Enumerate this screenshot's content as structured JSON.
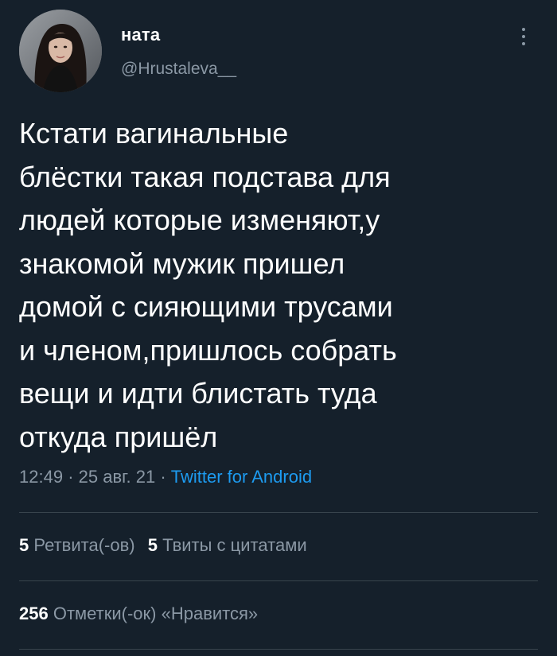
{
  "tweet": {
    "author": {
      "display_name": "ната",
      "handle": "@Hrustaleva__",
      "avatar_icon": "user-avatar-photo"
    },
    "more_icon": "vertical-ellipsis-icon",
    "text": "Кстати вагинальные\nблёстки такая подстава для\nлюдей которые изменяют,у\nзнакомой мужик пришел\nдомой с сияющими трусами\nи членом,пришлось собрать\nвещи и идти блистать туда\nоткуда пришёл",
    "time": "12:49",
    "separator": "·",
    "date": "25 авг. 21",
    "client": "Twitter for Android",
    "retweets": {
      "count": "5",
      "label": "Ретвита(-ов)"
    },
    "quotes": {
      "count": "5",
      "label": "Твиты с цитатами"
    },
    "likes": {
      "count": "256",
      "label": "Отметки(-ок) «Нравится»"
    }
  },
  "colors": {
    "background": "#15202b",
    "primary_text": "#ffffff",
    "secondary_text": "#8b98a5",
    "link": "#1d9bf0",
    "divider": "#38444d"
  }
}
